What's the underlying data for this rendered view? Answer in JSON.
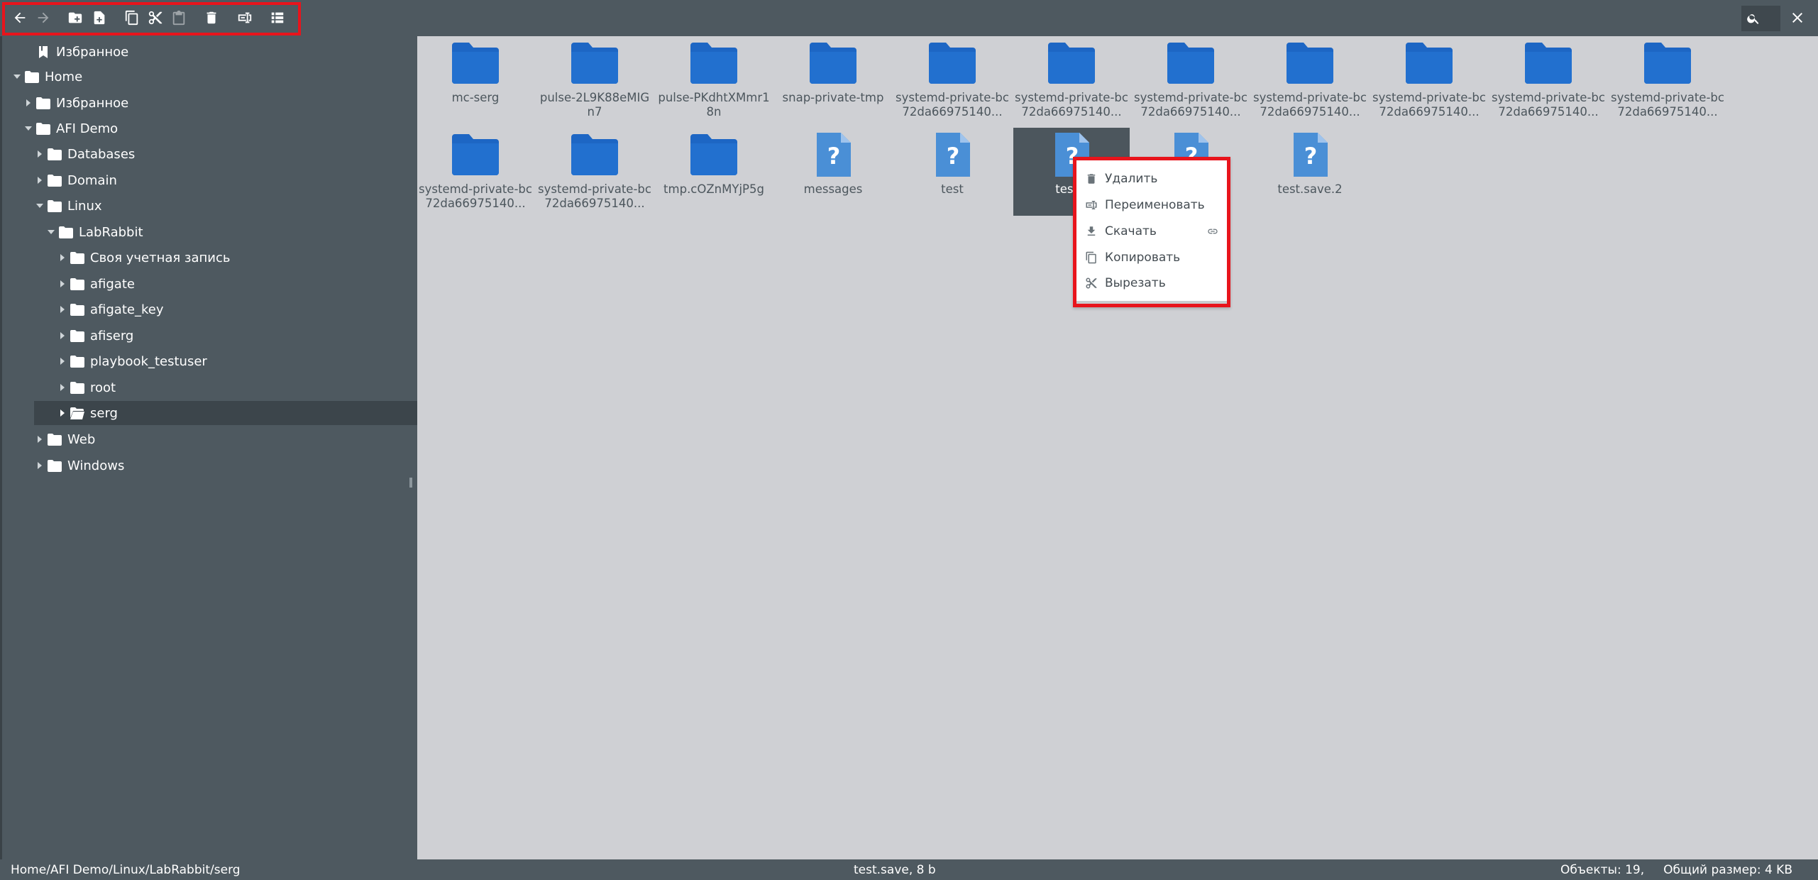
{
  "toolbar": {
    "buttons": [
      {
        "name": "back-button",
        "icon": "arrow-left-icon",
        "enabled": true
      },
      {
        "name": "forward-button",
        "icon": "arrow-right-icon",
        "enabled": false
      },
      {
        "name": "new-folder-button",
        "icon": "folder-plus-icon",
        "enabled": true
      },
      {
        "name": "new-file-button",
        "icon": "file-plus-icon",
        "enabled": true
      },
      {
        "name": "copy-button",
        "icon": "copy-icon",
        "enabled": true
      },
      {
        "name": "cut-button",
        "icon": "scissors-icon",
        "enabled": true
      },
      {
        "name": "paste-button",
        "icon": "clipboard-icon",
        "enabled": false
      },
      {
        "name": "delete-button",
        "icon": "trash-icon",
        "enabled": true
      },
      {
        "name": "rename-button",
        "icon": "rename-icon",
        "enabled": true
      },
      {
        "name": "view-toggle-button",
        "icon": "list-view-icon",
        "enabled": true
      }
    ],
    "highlight_color": "#e8141c"
  },
  "sidebar": {
    "tree": [
      {
        "label": "Избранное",
        "icon": "bookmark-icon",
        "arrow": "none"
      },
      {
        "label": "Home",
        "icon": "folder-icon",
        "arrow": "expanded"
      },
      {
        "label": "Избранное",
        "icon": "folder-icon",
        "arrow": "collapsed"
      },
      {
        "label": "AFI Demo",
        "icon": "folder-icon",
        "arrow": "expanded"
      },
      {
        "label": "Databases",
        "icon": "folder-icon",
        "arrow": "collapsed"
      },
      {
        "label": "Domain",
        "icon": "folder-icon",
        "arrow": "collapsed"
      },
      {
        "label": "Linux",
        "icon": "folder-icon",
        "arrow": "expanded"
      },
      {
        "label": "LabRabbit",
        "icon": "folder-icon",
        "arrow": "expanded"
      },
      {
        "label": "Своя учетная запись",
        "icon": "folder-icon",
        "arrow": "collapsed"
      },
      {
        "label": "afigate",
        "icon": "folder-icon",
        "arrow": "collapsed"
      },
      {
        "label": "afigate_key",
        "icon": "folder-icon",
        "arrow": "collapsed"
      },
      {
        "label": "afiserg",
        "icon": "folder-icon",
        "arrow": "collapsed"
      },
      {
        "label": "playbook_testuser",
        "icon": "folder-icon",
        "arrow": "collapsed"
      },
      {
        "label": "root",
        "icon": "folder-icon",
        "arrow": "collapsed"
      },
      {
        "label": "serg",
        "icon": "folder-open-icon",
        "arrow": "collapsed",
        "selected": true
      },
      {
        "label": "Web",
        "icon": "folder-icon",
        "arrow": "collapsed"
      },
      {
        "label": "Windows",
        "icon": "folder-icon",
        "arrow": "collapsed"
      }
    ]
  },
  "files": [
    {
      "label": "mc-serg",
      "type": "folder"
    },
    {
      "label": "pulse-2L9K88eMIGn7",
      "type": "folder"
    },
    {
      "label": "pulse-PKdhtXMmr18n",
      "type": "folder"
    },
    {
      "label": "snap-private-tmp",
      "type": "folder"
    },
    {
      "label": "systemd-private-bc72da66975140...",
      "type": "folder"
    },
    {
      "label": "systemd-private-bc72da66975140...",
      "type": "folder"
    },
    {
      "label": "systemd-private-bc72da66975140...",
      "type": "folder"
    },
    {
      "label": "systemd-private-bc72da66975140...",
      "type": "folder"
    },
    {
      "label": "systemd-private-bc72da66975140...",
      "type": "folder"
    },
    {
      "label": "systemd-private-bc72da66975140...",
      "type": "folder"
    },
    {
      "label": "systemd-private-bc72da66975140...",
      "type": "folder"
    },
    {
      "label": "systemd-private-bc72da66975140...",
      "type": "folder"
    },
    {
      "label": "systemd-private-bc72da66975140...",
      "type": "folder"
    },
    {
      "label": "tmp.cOZnMYjP5g",
      "type": "folder"
    },
    {
      "label": "messages",
      "type": "file"
    },
    {
      "label": "test",
      "type": "file"
    },
    {
      "label": "test.s",
      "type": "file",
      "selected": true
    },
    {
      "label": "",
      "type": "file"
    },
    {
      "label": "test.save.2",
      "type": "file"
    }
  ],
  "context_menu": {
    "items": [
      {
        "label": "Удалить",
        "icon": "trash-icon"
      },
      {
        "label": "Переименовать",
        "icon": "rename-icon"
      },
      {
        "label": "Скачать",
        "icon": "download-icon",
        "extra_icon": "link-icon"
      },
      {
        "label": "Копировать",
        "icon": "copy-icon"
      },
      {
        "label": "Вырезать",
        "icon": "scissors-icon"
      }
    ]
  },
  "status": {
    "path": "Home/AFI Demo/Linux/LabRabbit/serg",
    "selection": "test.save, 8 b",
    "summary": "Объекты: 19,     Общий размер: 4 KB"
  },
  "colors": {
    "panel": "#4e5960",
    "content_bg": "#cfd0d4",
    "folder_blue": "#1d66c4",
    "file_blue": "#4a8fd6",
    "highlight_red": "#e8141c"
  }
}
